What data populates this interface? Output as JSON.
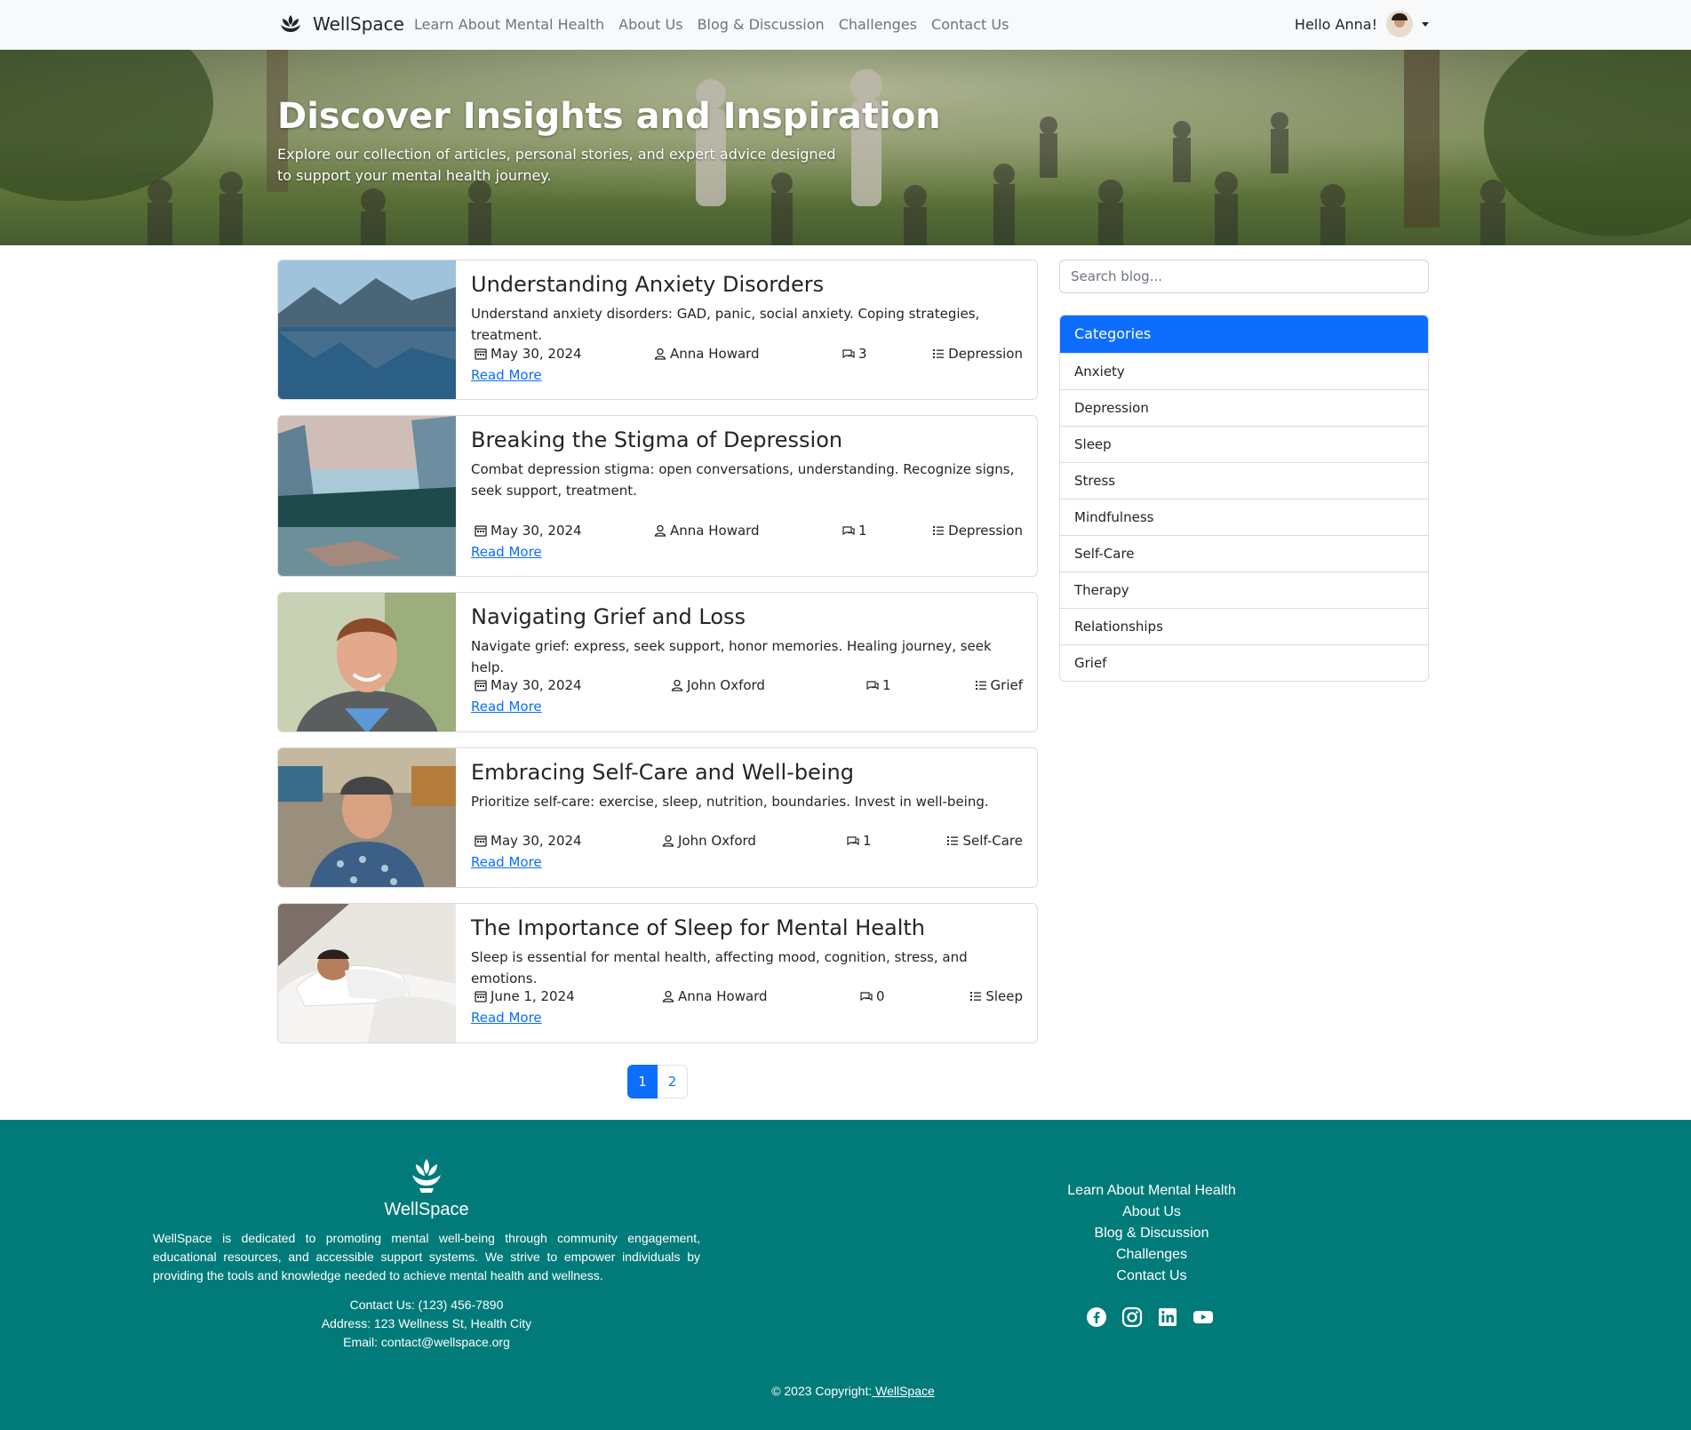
{
  "nav": {
    "brand": "WellSpace",
    "links": [
      "Learn About Mental Health",
      "About Us",
      "Blog & Discussion",
      "Challenges",
      "Contact Us"
    ],
    "greeting": "Hello Anna!"
  },
  "hero": {
    "title": "Discover Insights and Inspiration",
    "subtitle": "Explore our collection of articles, personal stories, and expert advice designed to support your mental health journey."
  },
  "posts": [
    {
      "title": "Understanding Anxiety Disorders",
      "excerpt": "Understand anxiety disorders: GAD, panic, social anxiety. Coping strategies, treatment.",
      "date": "May 30, 2024",
      "author": "Anna Howard",
      "comments": "3",
      "category": "Depression",
      "read_more": "Read More"
    },
    {
      "title": "Breaking the Stigma of Depression",
      "excerpt": "Combat depression stigma: open conversations, understanding. Recognize signs, seek support, treatment.",
      "date": "May 30, 2024",
      "author": "Anna Howard",
      "comments": "1",
      "category": "Depression",
      "read_more": "Read More"
    },
    {
      "title": "Navigating Grief and Loss",
      "excerpt": "Navigate grief: express, seek support, honor memories. Healing journey, seek help.",
      "date": "May 30, 2024",
      "author": "John Oxford",
      "comments": "1",
      "category": "Grief",
      "read_more": "Read More"
    },
    {
      "title": "Embracing Self-Care and Well-being",
      "excerpt": "Prioritize self-care: exercise, sleep, nutrition, boundaries. Invest in well-being.",
      "date": "May 30, 2024",
      "author": "John Oxford",
      "comments": "1",
      "category": "Self-Care",
      "read_more": "Read More"
    },
    {
      "title": "The Importance of Sleep for Mental Health",
      "excerpt": "Sleep is essential for mental health, affecting mood, cognition, stress, and emotions.",
      "date": "June 1, 2024",
      "author": "Anna Howard",
      "comments": "0",
      "category": "Sleep",
      "read_more": "Read More"
    }
  ],
  "sidebar": {
    "search_placeholder": "Search blog...",
    "categories_title": "Categories",
    "categories": [
      "Anxiety",
      "Depression",
      "Sleep",
      "Stress",
      "Mindfulness",
      "Self-Care",
      "Therapy",
      "Relationships",
      "Grief"
    ]
  },
  "pagination": {
    "pages": [
      "1",
      "2"
    ],
    "current": "1"
  },
  "footer": {
    "brand": "WellSpace",
    "about": "WellSpace is dedicated to promoting mental well-being through community engagement, educational resources, and accessible support systems. We strive to empower individuals by providing the tools and knowledge needed to achieve mental health and wellness.",
    "contact": "Contact Us: (123) 456-7890",
    "address": "Address: 123 Wellness St, Health City",
    "email": "Email: contact@wellspace.org",
    "links": [
      "Learn About Mental Health",
      "About Us",
      "Blog & Discussion",
      "Challenges",
      "Contact Us"
    ],
    "socials": [
      "facebook-icon",
      "instagram-icon",
      "linkedin-icon",
      "youtube-icon"
    ],
    "copyright": "© 2023 Copyright:",
    "copyright_link": " WellSpace"
  },
  "colors": {
    "primary": "#0d6efd",
    "footer": "#007b7a",
    "navbar": "#f8f9fa"
  }
}
